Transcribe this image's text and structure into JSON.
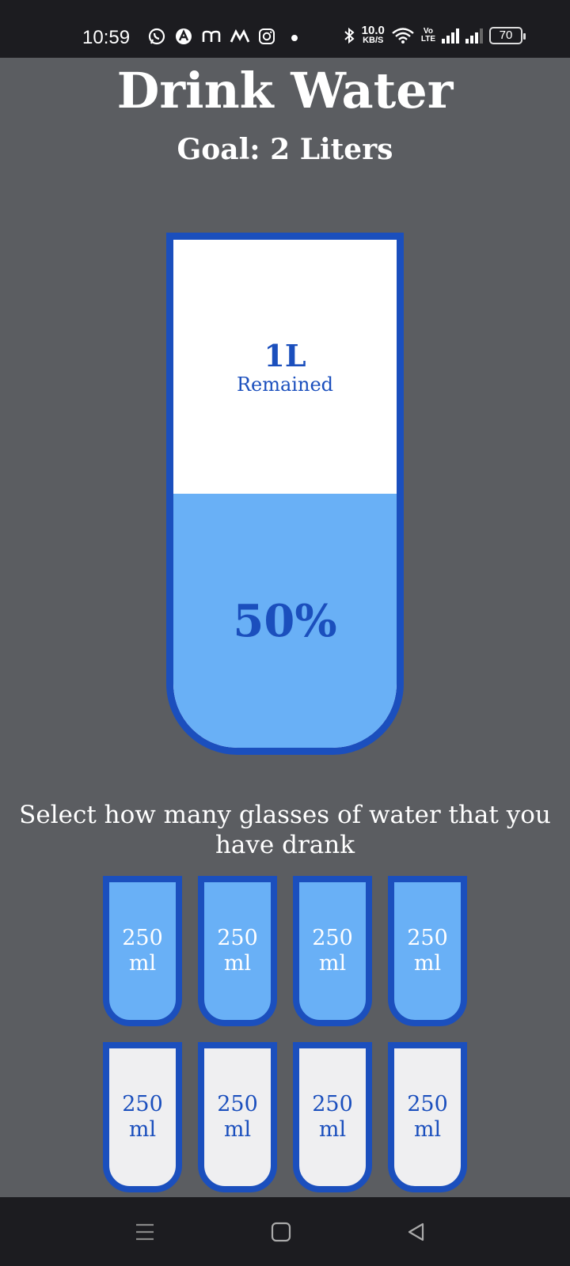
{
  "status_bar": {
    "time": "10:59",
    "speed_value": "10.0",
    "speed_unit": "KB/S",
    "volte_top": "Vo",
    "volte_bottom": "LTE",
    "battery": "70",
    "notification_icons": [
      "whatsapp-icon",
      "a-app-icon",
      "m-app-icon",
      "m-app-icon",
      "instagram-icon",
      "dot-icon"
    ]
  },
  "app": {
    "title": "Drink Water",
    "goal": "Goal: 2 Liters"
  },
  "cup": {
    "remained_amount": "1L",
    "remained_label": "Remained",
    "percentage_label": "50%",
    "fill_fraction": 0.5
  },
  "instruction": "Select how many glasses of water that you have drank",
  "glasses": [
    {
      "amount": "250",
      "unit": "ml",
      "full": true
    },
    {
      "amount": "250",
      "unit": "ml",
      "full": true
    },
    {
      "amount": "250",
      "unit": "ml",
      "full": true
    },
    {
      "amount": "250",
      "unit": "ml",
      "full": true
    },
    {
      "amount": "250",
      "unit": "ml",
      "full": false
    },
    {
      "amount": "250",
      "unit": "ml",
      "full": false
    },
    {
      "amount": "250",
      "unit": "ml",
      "full": false
    },
    {
      "amount": "250",
      "unit": "ml",
      "full": false
    }
  ],
  "colors": {
    "background": "#5b5d61",
    "accent": "#1b4fbd",
    "water": "#69b0f6",
    "empty_glass": "#efeff1"
  }
}
